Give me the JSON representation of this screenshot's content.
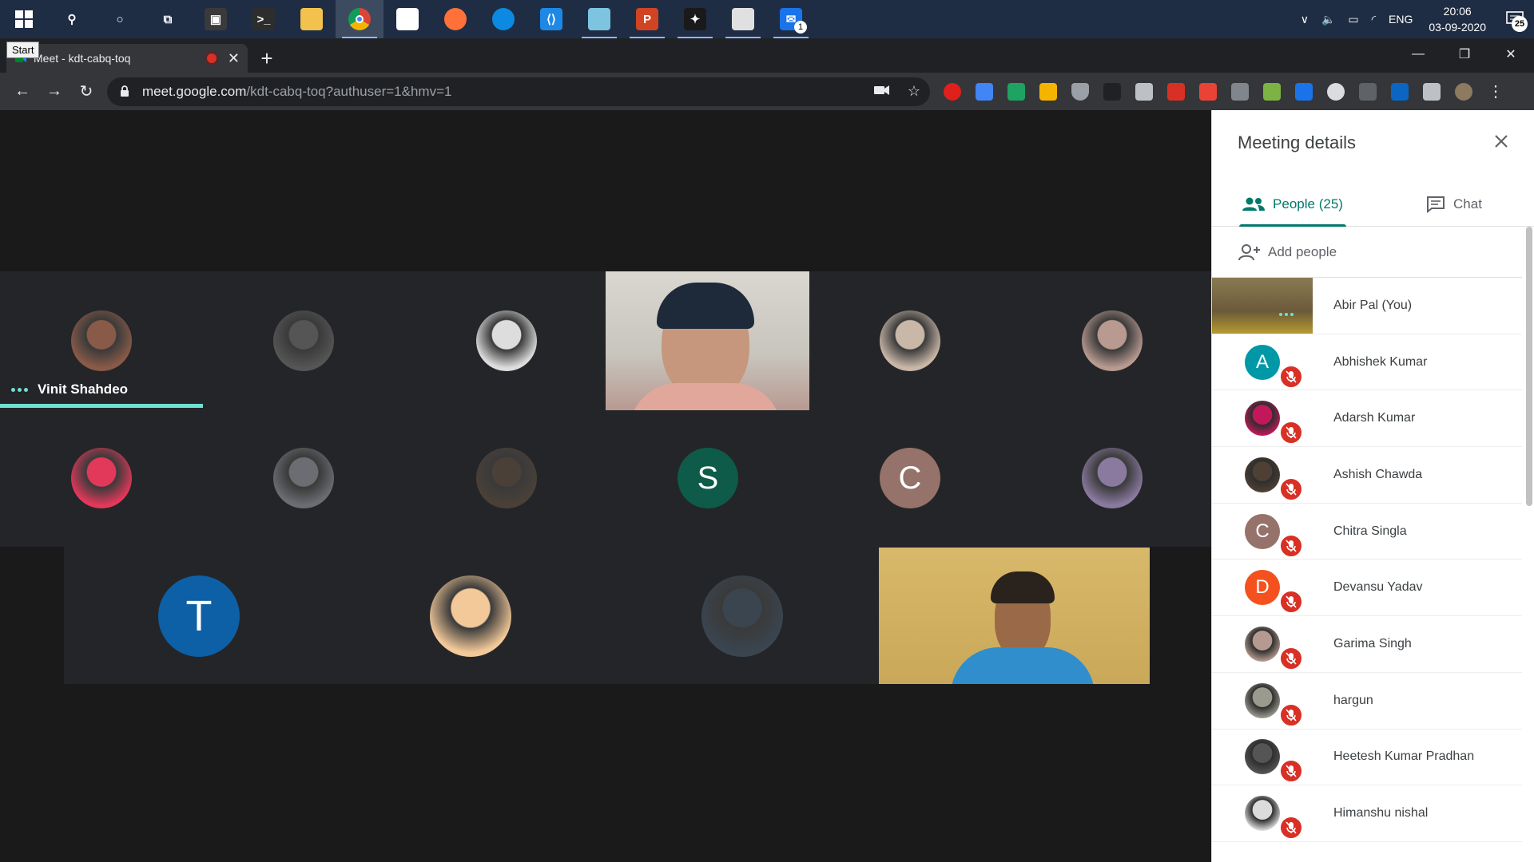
{
  "taskbar": {
    "start_tooltip": "Start",
    "apps": [
      {
        "name": "search-icon",
        "color": "#1f2d44",
        "glyph": "⚲"
      },
      {
        "name": "cortana-icon",
        "color": "#1f2d44",
        "glyph": "○"
      },
      {
        "name": "task-view-icon",
        "color": "#1f2d44",
        "glyph": "⧉"
      },
      {
        "name": "notepad-icon",
        "color": "#3a3a3a",
        "glyph": "▣"
      },
      {
        "name": "terminal-icon",
        "color": "#2d2d2d",
        "glyph": ">_"
      },
      {
        "name": "file-explorer-icon",
        "color": "#f2c14e",
        "glyph": ""
      },
      {
        "name": "chrome-icon",
        "color": "#db4437",
        "glyph": ""
      },
      {
        "name": "store-icon",
        "color": "#ffffff",
        "glyph": ""
      },
      {
        "name": "firefox-icon",
        "color": "#ff7139",
        "glyph": ""
      },
      {
        "name": "edge-icon",
        "color": "#0c8ae1",
        "glyph": ""
      },
      {
        "name": "vscode-icon",
        "color": "#1e88e5",
        "glyph": "⟨⟩"
      },
      {
        "name": "pen-app-icon",
        "color": "#7cc4e0",
        "glyph": ""
      },
      {
        "name": "powerpoint-icon",
        "color": "#d04423",
        "glyph": "P"
      },
      {
        "name": "figma-icon",
        "color": "#1a1a1a",
        "glyph": "✦"
      },
      {
        "name": "paint-icon",
        "color": "#e0e0e0",
        "glyph": ""
      },
      {
        "name": "mail-icon",
        "color": "#1a73e8",
        "glyph": "✉"
      }
    ],
    "lang": "ENG",
    "time": "20:06",
    "date": "03-09-2020",
    "notif_count": "25"
  },
  "browser": {
    "tab_title": "Meet - kdt-cabq-toq",
    "url_host": "meet.google.com",
    "url_path": "/kdt-cabq-toq?authuser=1&hmv=1"
  },
  "stage": {
    "active_speaker": "Vinit Shahdeo",
    "row1": [
      {
        "name": "Vinit Shahdeo",
        "kind": "photo",
        "color": "#8a5a48"
      },
      {
        "name": "participant-2",
        "kind": "photo",
        "color": "#555"
      },
      {
        "name": "participant-3",
        "kind": "photo",
        "color": "#ddd"
      },
      {
        "name": "video-1",
        "kind": "video"
      },
      {
        "name": "participant-5",
        "kind": "photo",
        "color": "#c9b7a8"
      },
      {
        "name": "participant-6",
        "kind": "photo",
        "color": "#b89a90"
      }
    ],
    "row2": [
      {
        "name": "participant-7",
        "kind": "photo",
        "color": "#e2385a"
      },
      {
        "name": "participant-8",
        "kind": "photo",
        "color": "#6b6d72"
      },
      {
        "name": "participant-9",
        "kind": "photo",
        "color": "#4a4038"
      },
      {
        "name": "S",
        "kind": "letter",
        "color": "#0d5b48"
      },
      {
        "name": "C",
        "kind": "letter",
        "color": "#95736a"
      },
      {
        "name": "participant-12",
        "kind": "photo",
        "color": "#8a7aa0"
      }
    ],
    "row3": [
      {
        "name": "T",
        "kind": "letter",
        "color": "#0d5fa6"
      },
      {
        "name": "participant-14",
        "kind": "photo",
        "color": "#f3c99a"
      },
      {
        "name": "participant-15",
        "kind": "photo",
        "color": "#3a4550"
      },
      {
        "name": "video-2",
        "kind": "video"
      }
    ]
  },
  "panel": {
    "title": "Meeting details",
    "tab_people": "People (25)",
    "tab_chat": "Chat",
    "add_people": "Add people",
    "people": [
      {
        "name": "Abir Pal (You)",
        "letter": "",
        "color": "#6b5a40",
        "muted": false,
        "self": true
      },
      {
        "name": "Abhishek Kumar",
        "letter": "A",
        "color": "#0097a7",
        "muted": true
      },
      {
        "name": "Adarsh Kumar",
        "letter": "",
        "color": "#c2185b",
        "muted": true
      },
      {
        "name": "Ashish Chawda",
        "letter": "",
        "color": "#4e4034",
        "muted": true
      },
      {
        "name": "Chitra Singla",
        "letter": "C",
        "color": "#95736a",
        "muted": true
      },
      {
        "name": "Devansu Yadav",
        "letter": "D",
        "color": "#f4511e",
        "muted": true
      },
      {
        "name": "Garima Singh",
        "letter": "",
        "color": "#b59a90",
        "muted": true
      },
      {
        "name": "hargun",
        "letter": "",
        "color": "#9a9a8e",
        "muted": true
      },
      {
        "name": "Heetesh Kumar Pradhan",
        "letter": "",
        "color": "#555555",
        "muted": true
      },
      {
        "name": "Himanshu nishal",
        "letter": "",
        "color": "#dcdcdc",
        "muted": true
      }
    ]
  },
  "colors": {
    "accent": "#00796b",
    "mute_red": "#d93025",
    "speaker": "#6fe0d4"
  }
}
